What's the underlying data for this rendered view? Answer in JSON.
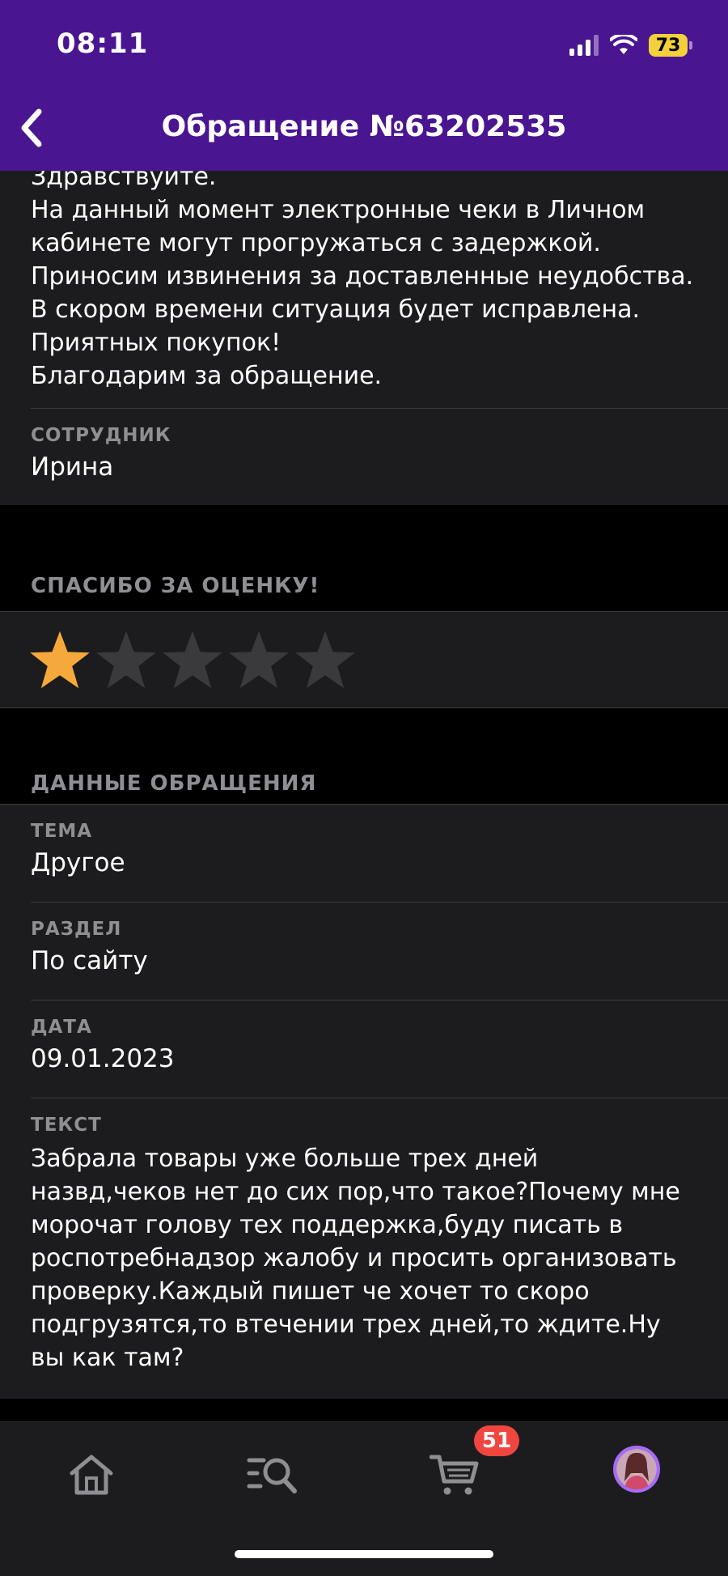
{
  "status_bar": {
    "time": "08:11",
    "battery": "73"
  },
  "nav": {
    "title": "Обращение №63202535"
  },
  "answer": {
    "text": "Здравствуйте.\nНа данный момент электронные чеки в Личном кабинете могут прогружаться с задержкой. Приносим извинения за доставленные неудобства. В скором времени ситуация будет исправлена. Приятных покупок!\nБлагодарим за обращение.",
    "employee_label": "СОТРУДНИК",
    "employee_value": "Ирина"
  },
  "rating": {
    "title": "СПАСИБО ЗА ОЦЕНКУ!",
    "value": 1,
    "max": 5,
    "active_color": "#f6a93b",
    "inactive_color": "#3a3a3c"
  },
  "details": {
    "title": "ДАННЫЕ ОБРАЩЕНИЯ",
    "fields": [
      {
        "label": "ТЕМА",
        "value": "Другое"
      },
      {
        "label": "РАЗДЕЛ",
        "value": "По сайту"
      },
      {
        "label": "ДАТА",
        "value": "09.01.2023"
      },
      {
        "label": "ТЕКСТ",
        "value": "Забрала товары уже больше трех дней назвд,чеков нет до сих пор,что такое?Почему мне морочат голову тех поддержка,буду писать в роспотребнадзор жалобу и просить организовать проверку.Каждый пишет че хочет то скоро подгрузятся,то втечении трех дней,то ждите.Ну вы как там?"
      }
    ]
  },
  "tabbar": {
    "items": [
      "home-icon",
      "catalog-search-icon",
      "cart-icon",
      "profile-avatar"
    ],
    "cart_badge": "51"
  },
  "colors": {
    "header_bg": "#4a1590",
    "card_bg": "#1c1c1e",
    "accent": "#a66bff",
    "badge": "#f0463f"
  }
}
